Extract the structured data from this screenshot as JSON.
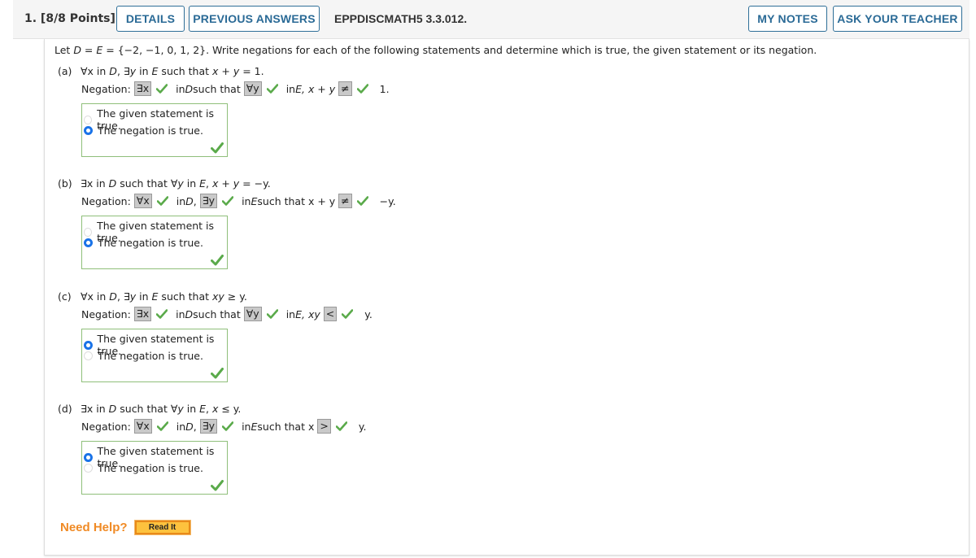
{
  "header": {
    "question_number": "1. [8/8 Points]",
    "details_label": "DETAILS",
    "previous_answers_label": "PREVIOUS ANSWERS",
    "question_id": "EPPDISCMATH5 3.3.012.",
    "my_notes_label": "MY NOTES",
    "ask_teacher_label": "ASK YOUR TEACHER"
  },
  "intro": {
    "prefix": "Let ",
    "D": "D",
    "eq": " = ",
    "E": "E",
    "rest": " = {−2, −1, 0, 1, 2}. Write negations for each of the following statements and determine which is true, the given statement or its negation."
  },
  "negation_label": "Negation:",
  "options": [
    "The given statement is true.",
    "The negation is true."
  ],
  "parts": [
    {
      "label": "(a)",
      "statement": [
        "∀x",
        " in ",
        "D",
        ", ∃",
        "y",
        " in ",
        "E",
        " such that ",
        "x + y",
        " = 1."
      ],
      "neg": {
        "sel1": "∃x",
        "t1a": "in ",
        "t1b": "D",
        "t1c": " such that",
        "sel2": "∀y",
        "t2a": "in ",
        "t2b": "E, x + y",
        "t2c": "",
        "sel3": "≠",
        "t3": "1."
      },
      "selected": 1,
      "correct": true
    },
    {
      "label": "(b)",
      "statement": [
        "∃x",
        " in ",
        "D",
        " such that ∀",
        "y",
        " in ",
        "E",
        ", ",
        "x + y",
        " = −y."
      ],
      "neg": {
        "sel1": "∀x",
        "t1a": "in ",
        "t1b": "D",
        "t1c": ",",
        "sel2": "∃y",
        "t2a": "in ",
        "t2b": "E",
        "t2c": " such that x + y",
        "sel3": "≠",
        "t3": "−y."
      },
      "selected": 1,
      "correct": true
    },
    {
      "label": "(c)",
      "statement": [
        "∀x",
        " in ",
        "D",
        ", ∃",
        "y",
        " in ",
        "E",
        " such that ",
        "xy",
        " ≥ y."
      ],
      "neg": {
        "sel1": "∃x",
        "t1a": "in ",
        "t1b": "D",
        "t1c": " such that",
        "sel2": "∀y",
        "t2a": "in ",
        "t2b": "E, xy",
        "t2c": "",
        "sel3": "<",
        "t3": "y."
      },
      "selected": 0,
      "correct": true
    },
    {
      "label": "(d)",
      "statement": [
        "∃x",
        " in ",
        "D",
        " such that ∀",
        "y",
        " in ",
        "E",
        ", ",
        "x",
        " ≤ y."
      ],
      "neg": {
        "sel1": "∀x",
        "t1a": "in ",
        "t1b": "D",
        "t1c": ",",
        "sel2": "∃y",
        "t2a": "in ",
        "t2b": "E",
        "t2c": " such that x",
        "sel3": ">",
        "t3": "y."
      },
      "selected": 0,
      "correct": true
    }
  ],
  "help": {
    "need_help": "Need Help?",
    "read_it": "Read It"
  },
  "colors": {
    "accent_blue": "#2a6a96",
    "check_green": "#5aaa4a",
    "radio_blue": "#1a73e8",
    "help_orange": "#f08a24"
  }
}
